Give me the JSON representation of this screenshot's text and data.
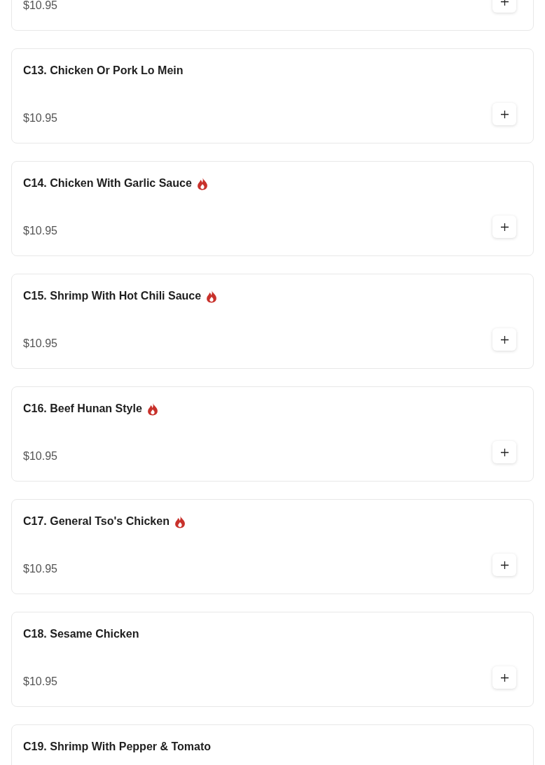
{
  "items": [
    {
      "price": "$10.95",
      "spicy": false
    },
    {
      "name": "C13. Chicken Or Pork Lo Mein",
      "price": "$10.95",
      "spicy": false
    },
    {
      "name": "C14. Chicken With Garlic Sauce",
      "price": "$10.95",
      "spicy": true
    },
    {
      "name": "C15. Shrimp With Hot Chili Sauce",
      "price": "$10.95",
      "spicy": true
    },
    {
      "name": "C16. Beef Hunan Style",
      "price": "$10.95",
      "spicy": true
    },
    {
      "name": "C17. General Tso's Chicken",
      "price": "$10.95",
      "spicy": true
    },
    {
      "name": "C18. Sesame Chicken",
      "price": "$10.95",
      "spicy": false
    },
    {
      "name": "C19. Shrimp With Pepper & Tomato",
      "spicy": false
    }
  ]
}
